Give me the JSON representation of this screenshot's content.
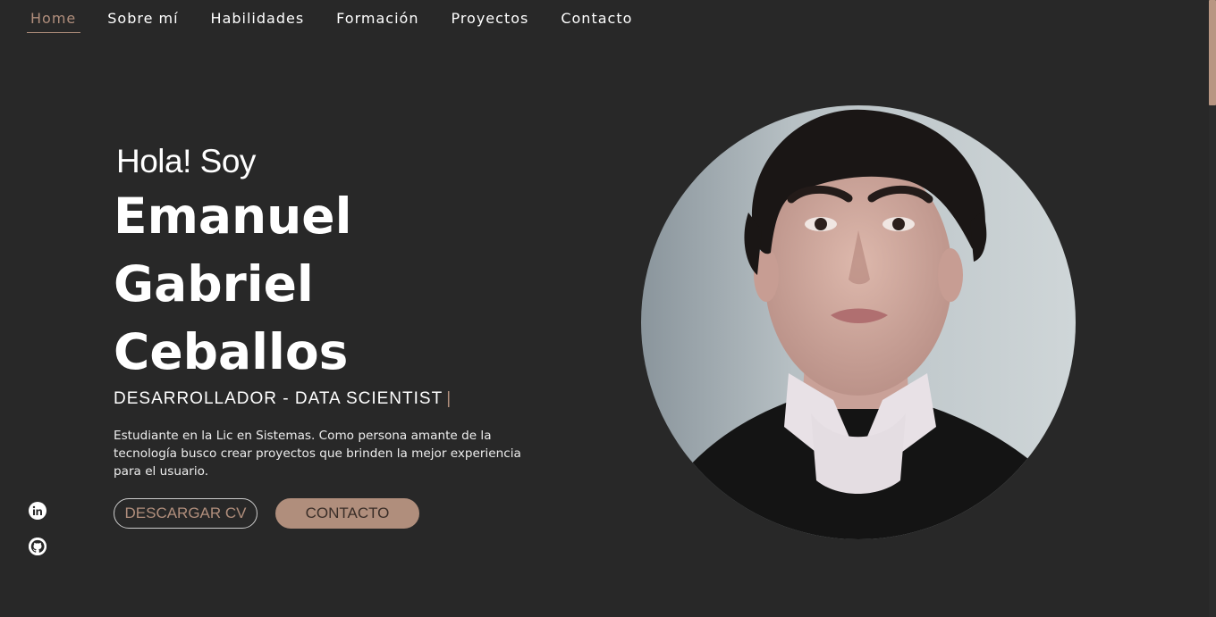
{
  "nav": {
    "items": [
      {
        "label": "Home",
        "active": true
      },
      {
        "label": "Sobre mí"
      },
      {
        "label": "Habilidades"
      },
      {
        "label": "Formación"
      },
      {
        "label": "Proyectos"
      },
      {
        "label": "Contacto"
      }
    ]
  },
  "hero": {
    "greeting": "Hola! Soy",
    "name_line1": "Emanuel Gabriel",
    "name_line2": "Ceballos",
    "role": "DESARROLLADOR - DATA SCIENTIST",
    "cursor": "|",
    "description": "Estudiante en la Lic en Sistemas. Como persona amante de la tecnología busco crear proyectos que brinden la mejor experiencia para el usuario.",
    "download_cv_label": "DESCARGAR CV",
    "contact_label": "CONTACTO"
  },
  "socials": [
    {
      "icon": "linkedin-icon"
    },
    {
      "icon": "github-icon"
    }
  ],
  "colors": {
    "background": "#282828",
    "accent": "#b08e7c",
    "text": "#ffffff"
  }
}
